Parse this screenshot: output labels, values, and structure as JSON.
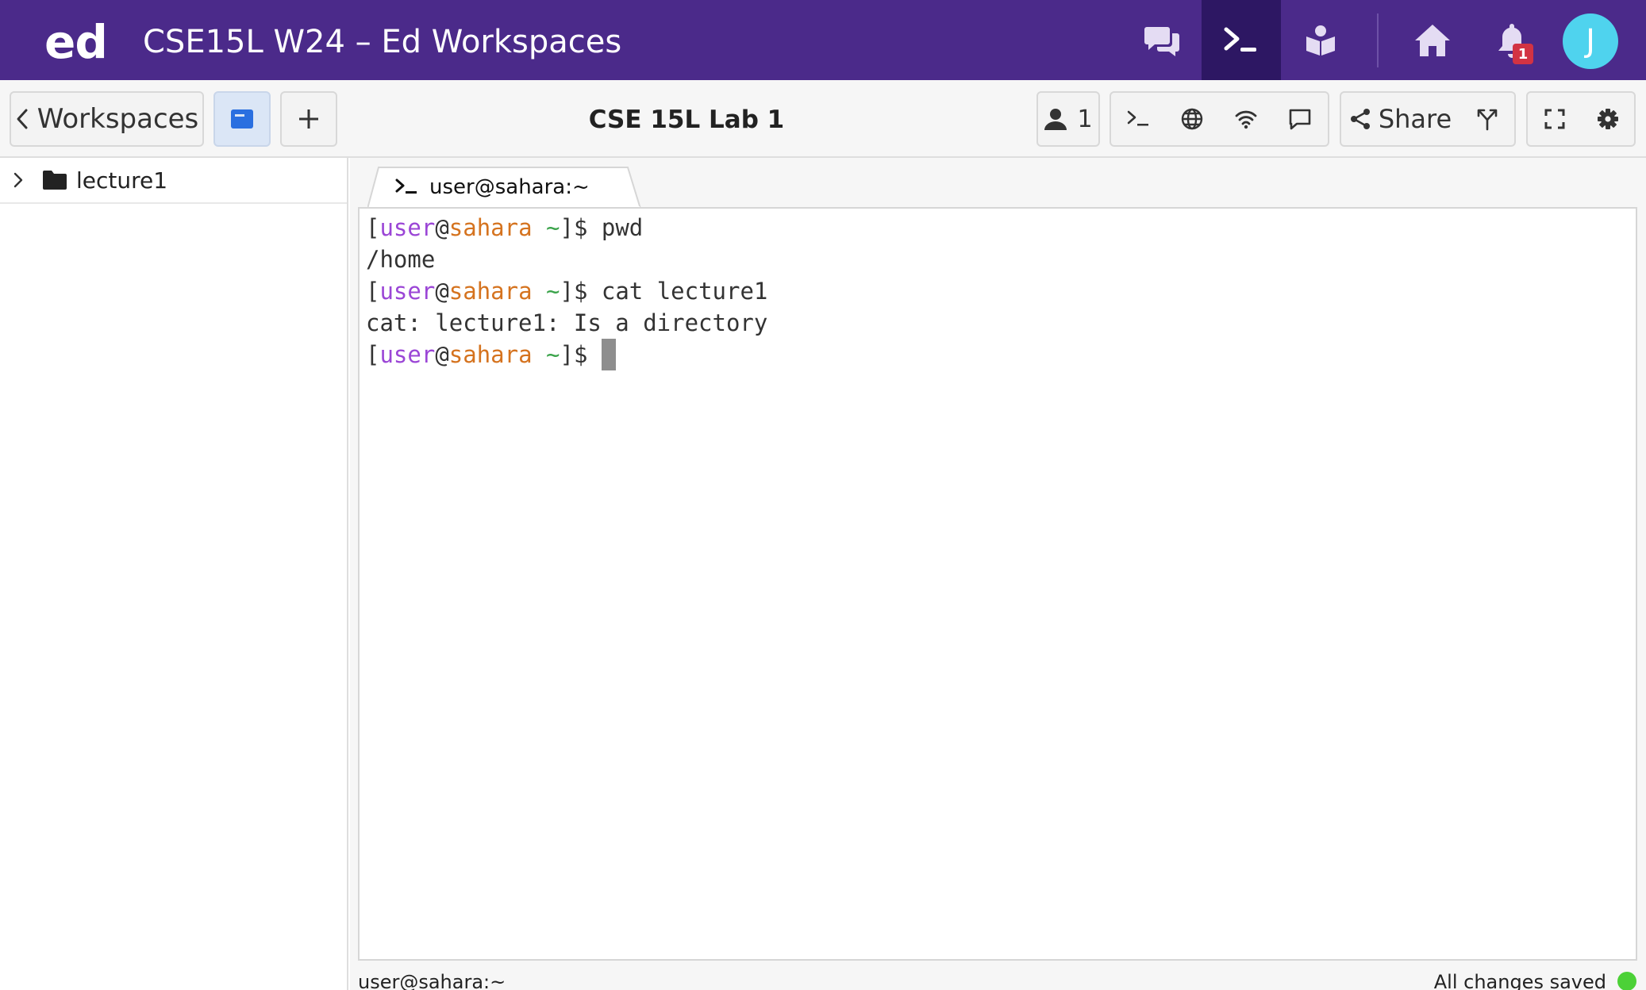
{
  "header": {
    "logo": "ed",
    "title": "CSE15L W24 – Ed Workspaces",
    "nav": [
      {
        "icon": "discussion-icon",
        "active": false
      },
      {
        "icon": "terminal-icon",
        "active": true
      },
      {
        "icon": "lessons-icon",
        "active": false
      },
      {
        "icon": "home-icon",
        "active": false
      },
      {
        "icon": "bell-icon",
        "active": false
      }
    ],
    "notification_count": "1",
    "avatar_initial": "J"
  },
  "toolbar": {
    "back_label": "Workspaces",
    "workspace_name": "CSE 15L Lab 1",
    "users_count": "1",
    "share_label": "Share"
  },
  "sidebar": {
    "items": [
      {
        "label": "lecture1",
        "type": "folder",
        "expanded": false
      }
    ]
  },
  "terminal": {
    "tab_label": "user@sahara:~",
    "prompt": {
      "user": "user",
      "at": "@",
      "host": "sahara",
      "dir": "~",
      "open": "[",
      "close": "]",
      "symbol": "$"
    },
    "lines": [
      {
        "kind": "command",
        "text": "pwd"
      },
      {
        "kind": "output",
        "text": "/home"
      },
      {
        "kind": "command",
        "text": "cat lecture1"
      },
      {
        "kind": "output",
        "text": "cat: lecture1: Is a directory"
      },
      {
        "kind": "command",
        "text": ""
      }
    ]
  },
  "status": {
    "left": "user@sahara:~",
    "right": "All changes saved",
    "saved_color": "#4cd137"
  },
  "colors": {
    "header_bg": "#4b2a8a",
    "header_active": "#2d1763",
    "prompt_user": "#9b46d6",
    "prompt_host": "#d5731f",
    "prompt_dir": "#3aa34a",
    "badge": "#d23343",
    "avatar": "#4fd3ee"
  }
}
